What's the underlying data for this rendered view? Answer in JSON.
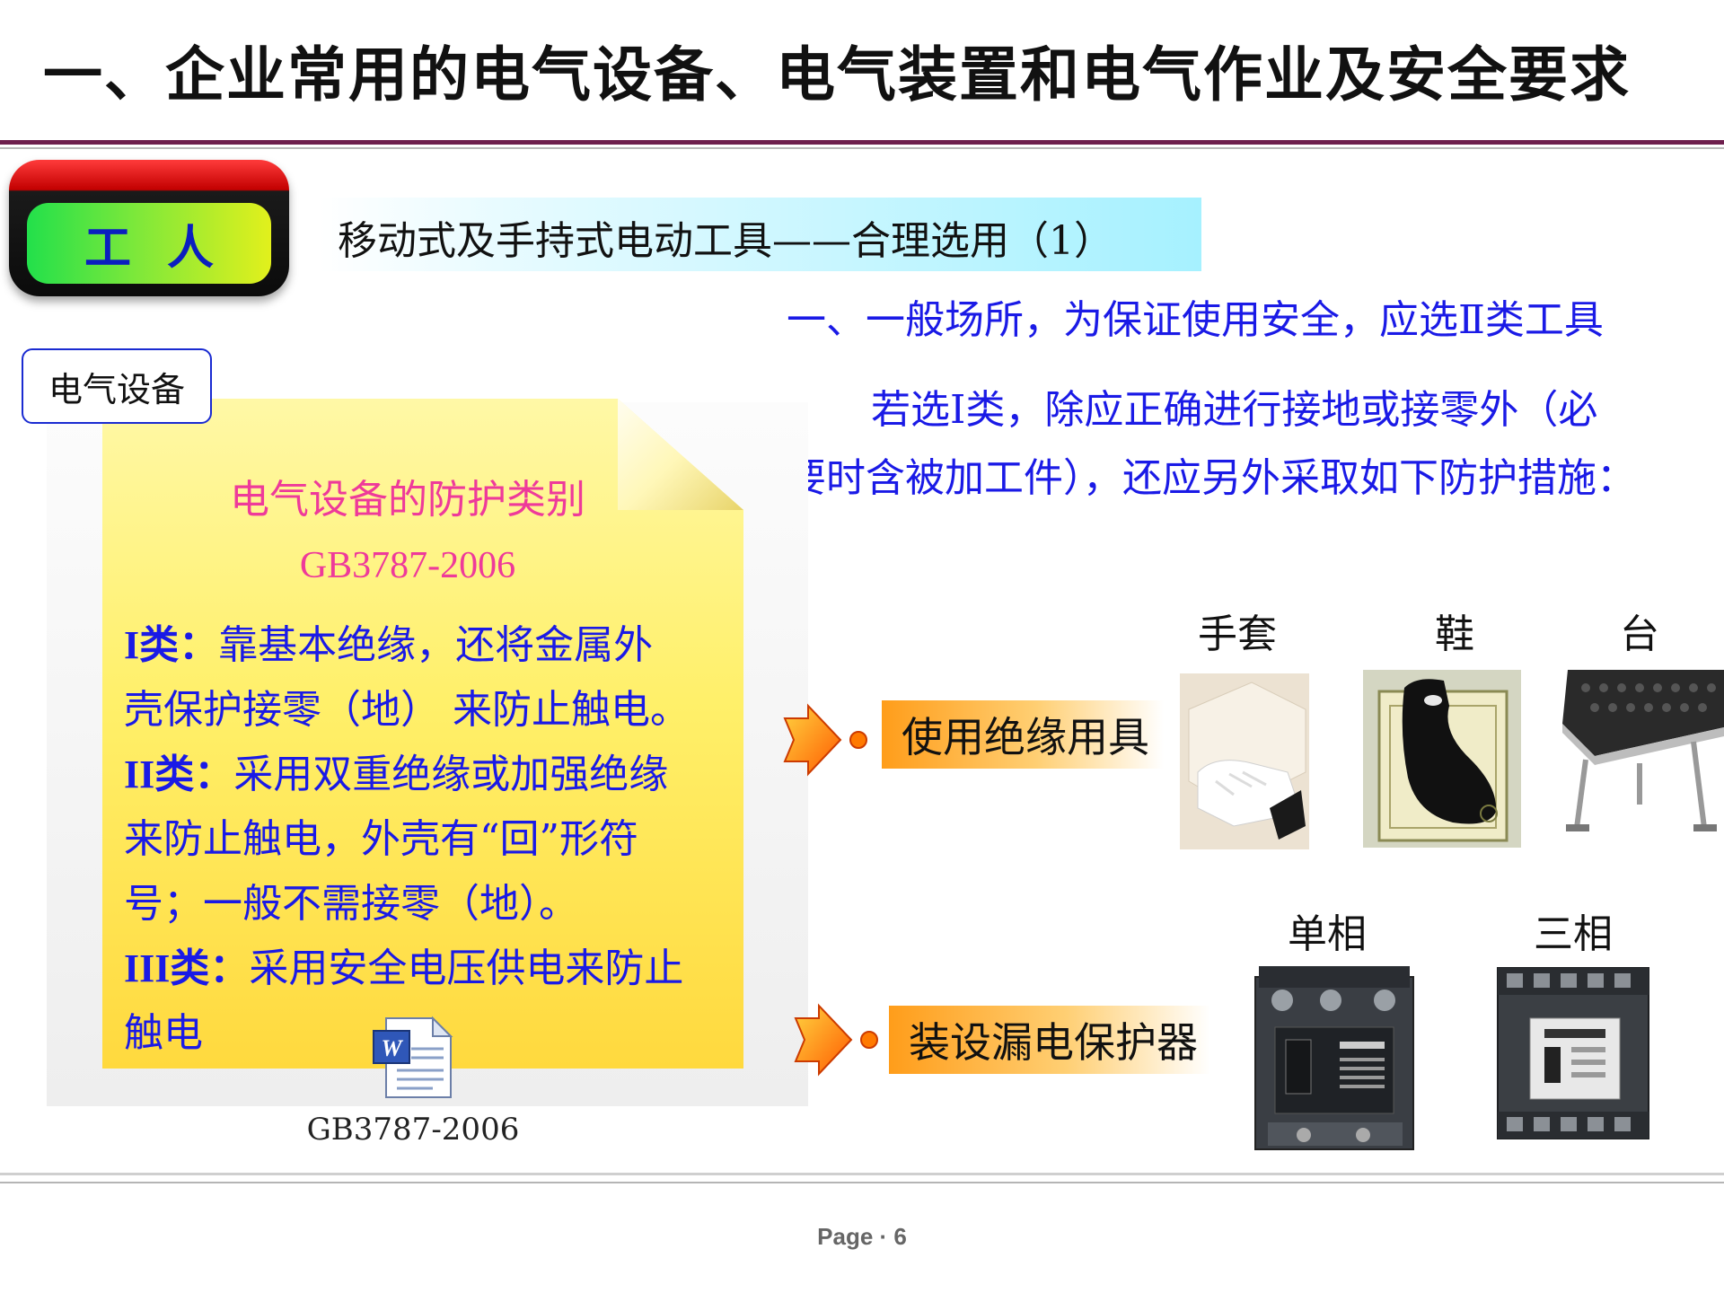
{
  "title": "一、企业常用的电气设备、电气装置和电气作业及安全要求",
  "badge": {
    "text": "工人"
  },
  "subtitle": "移动式及手持式电动工具——合理选用（1）",
  "right_text": {
    "line1": "一、一般场所，为保证使用安全，应选Ⅱ类工具",
    "line2": "若选Ⅰ类，除应正确进行接地或接零外（必",
    "line3": "要时含被加工件），还应另外采取如下防护措施："
  },
  "equipment_tag": "电气设备",
  "note": {
    "heading": "电气设备的防护类别",
    "standard": "GB3787-2006",
    "class1_label": "I类：",
    "class1_text_a": "靠基本绝缘，还将金属外",
    "class1_text_b": "壳保护接零（地） 来防止触电。",
    "class2_label": "II类：",
    "class2_text_a": "采用双重绝缘或加强绝缘",
    "class2_text_b": "来防止触电，外壳有“回”形符",
    "class2_text_c": "号；一般不需接零（地）。",
    "class3_label": "III类：",
    "class3_text_a": "采用安全电压供电来防止",
    "class3_text_b": "触电"
  },
  "doc_icon": {
    "icon": "word-document-icon",
    "caption": "GB3787-2006"
  },
  "insulation": {
    "label": "使用绝缘用具",
    "items": [
      "手套",
      "鞋",
      "台"
    ]
  },
  "rcd": {
    "label": "装设漏电保护器",
    "items": [
      "单相",
      "三相"
    ]
  },
  "footer": {
    "page": "Page · 6"
  },
  "colors": {
    "title_rule": "#6e1f4d",
    "blue_text": "#1a1ae6",
    "pink_text": "#ee3a9a",
    "orange_label": "#ff9d1a",
    "cyan_bar": "#a6f1ff"
  }
}
